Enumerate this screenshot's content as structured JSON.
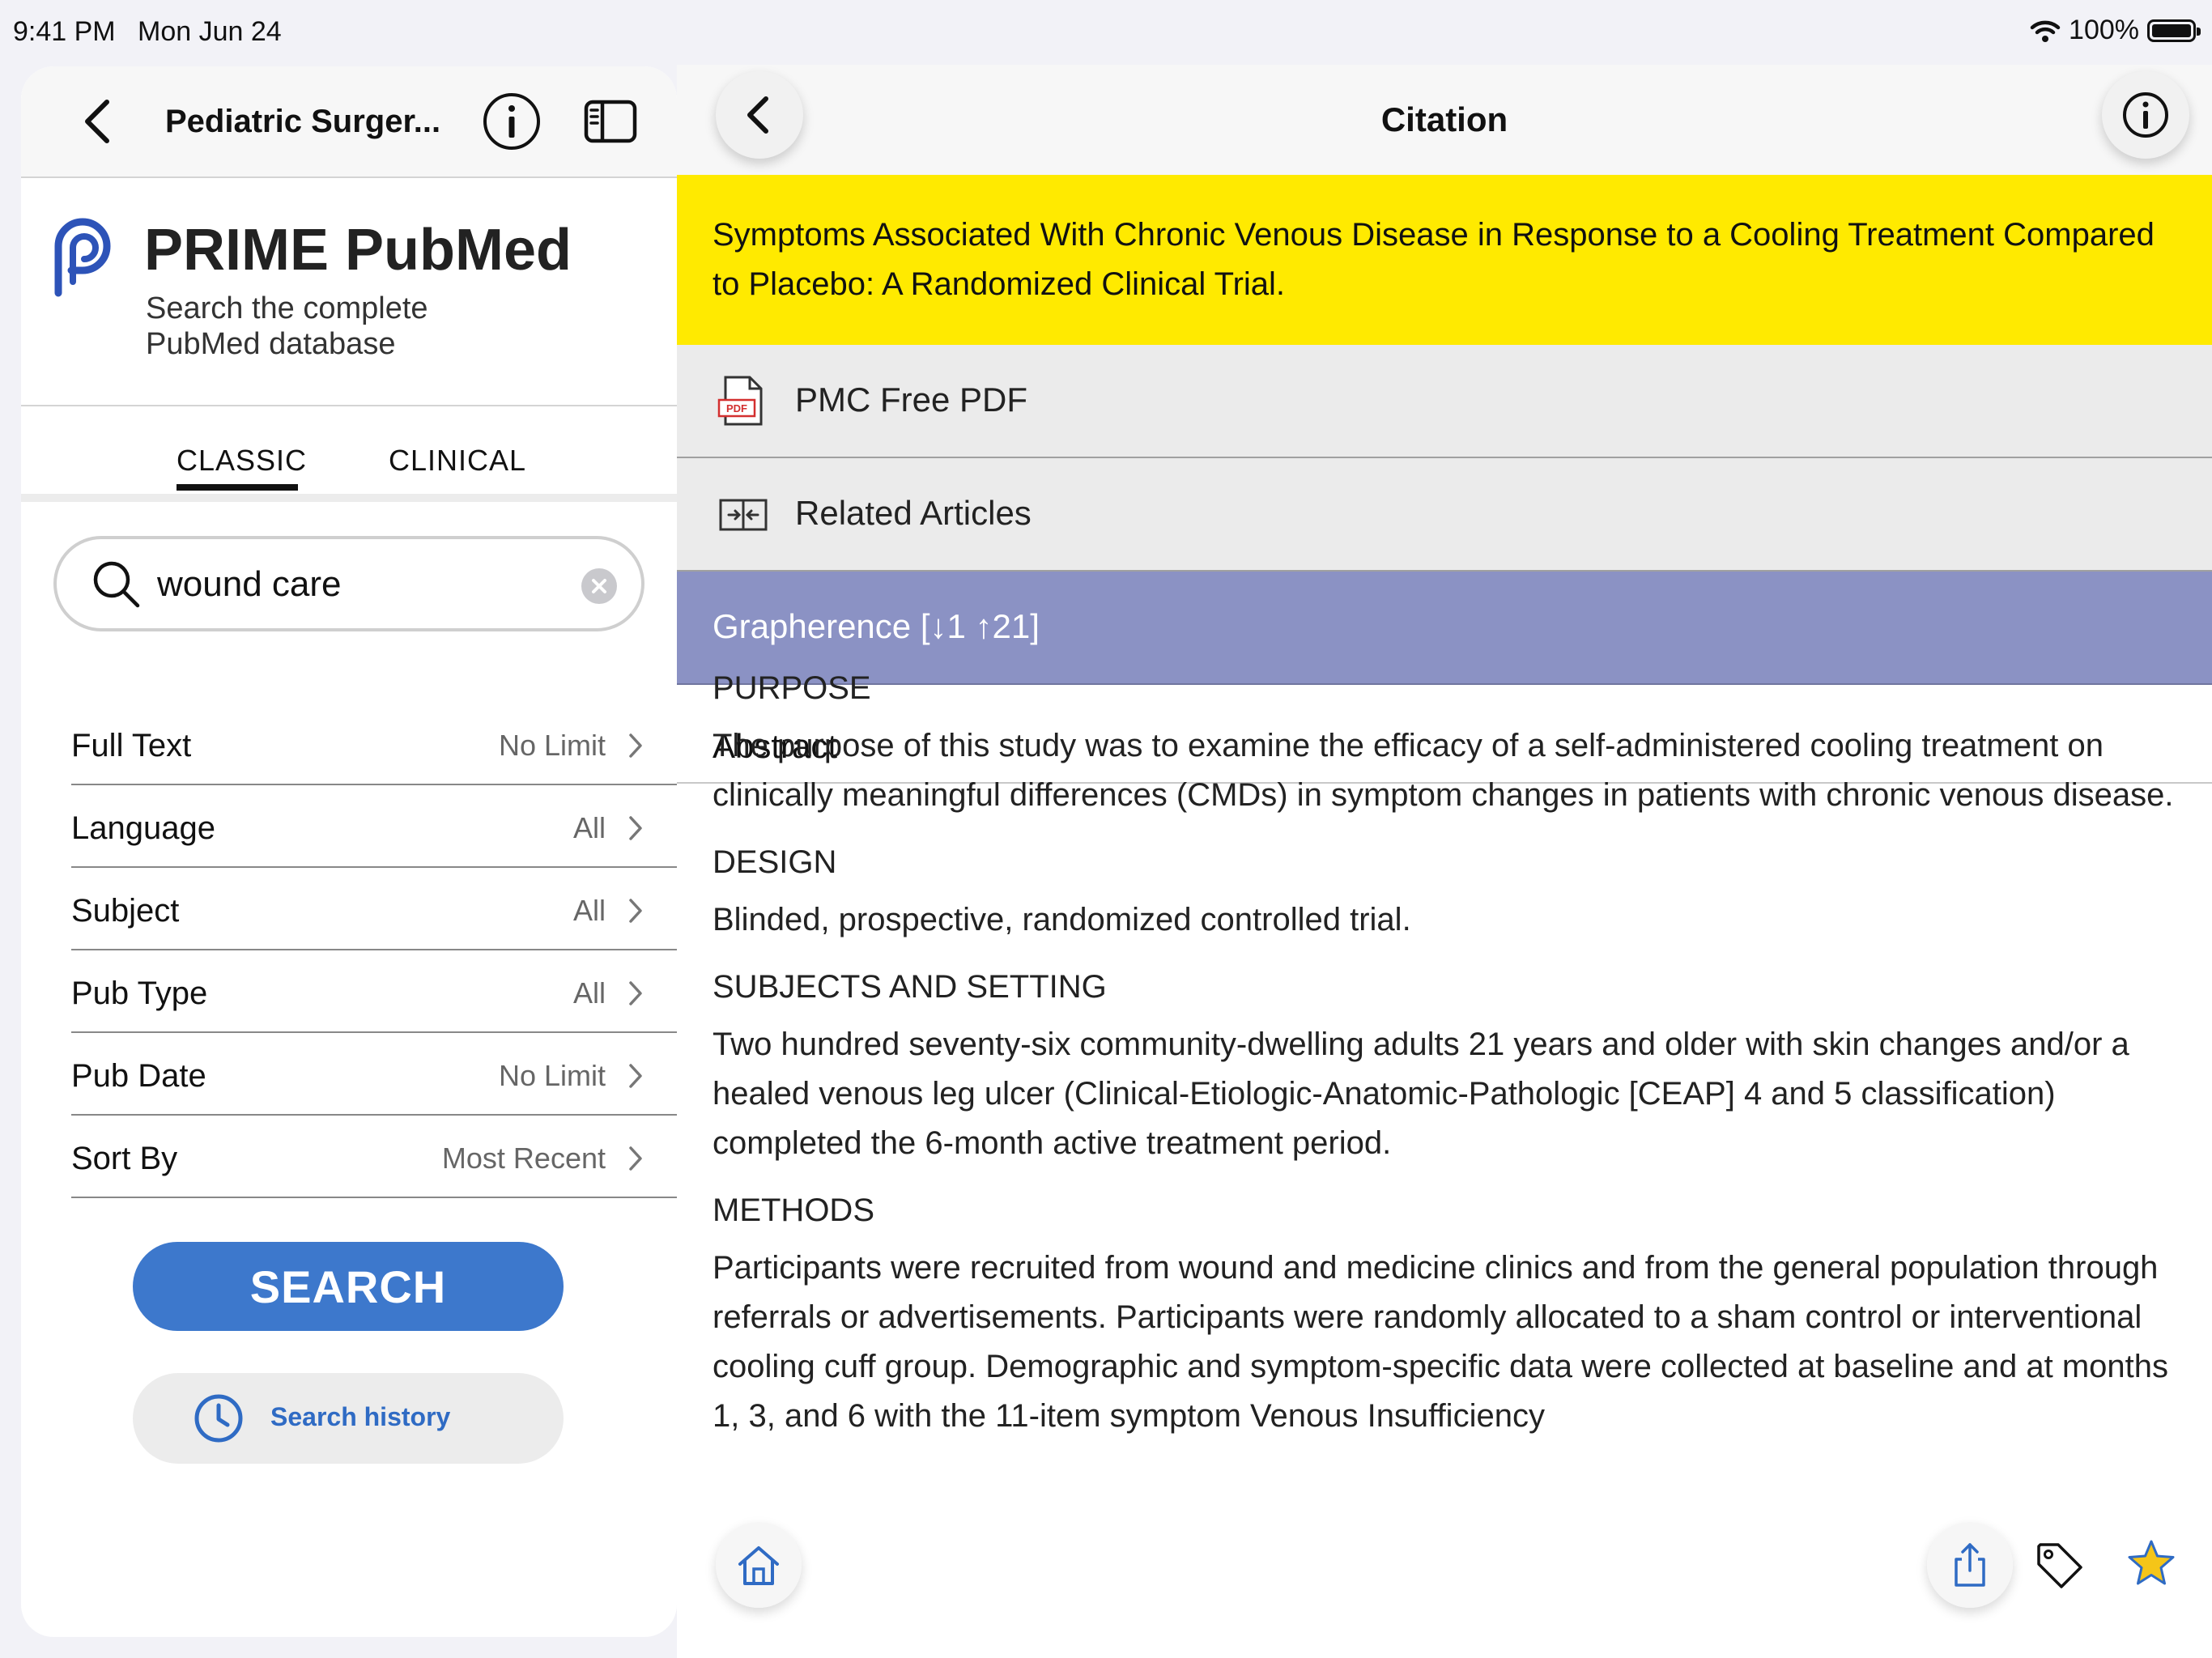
{
  "status_bar": {
    "time": "9:41 PM",
    "date": "Mon Jun 24",
    "battery": "100%"
  },
  "left": {
    "nav_title": "Pediatric Surger...",
    "brand": {
      "name": "PRIME PubMed",
      "tagline_1": "Search the complete",
      "tagline_2": "PubMed database"
    },
    "tabs": [
      {
        "label": "CLASSIC"
      },
      {
        "label": "CLINICAL"
      }
    ],
    "active_tab": "CLASSIC",
    "search": {
      "value": "wound care",
      "placeholder": ""
    },
    "filters": [
      {
        "label": "Full Text",
        "value": "No Limit"
      },
      {
        "label": "Language",
        "value": "All"
      },
      {
        "label": "Subject",
        "value": "All"
      },
      {
        "label": "Pub Type",
        "value": "All"
      },
      {
        "label": "Pub Date",
        "value": "No Limit"
      },
      {
        "label": "Sort By",
        "value": "Most Recent"
      }
    ],
    "search_button": "SEARCH",
    "history_button": "Search history"
  },
  "right": {
    "nav_title": "Citation",
    "article_title": "Symptoms Associated With Chronic Venous Disease in Response to a Cooling Treatment Compared to Placebo: A Randomized Clinical Trial.",
    "links": [
      {
        "label": "PMC Free PDF",
        "icon": "pdf-icon"
      },
      {
        "label": "Related Articles",
        "icon": "related-articles-icon"
      }
    ],
    "grapherence": "Grapherence [↓1 ↑21]",
    "abstract_header": "Abstract",
    "sections": [
      {
        "heading": "PURPOSE",
        "text": "The purpose of this study was to examine the efficacy of a self-administered cooling treatment on clinically meaningful differences (CMDs) in symptom changes in patients with chronic venous disease."
      },
      {
        "heading": "DESIGN",
        "text": "Blinded, prospective, randomized controlled trial."
      },
      {
        "heading": "SUBJECTS AND SETTING",
        "text": "Two hundred seventy-six community-dwelling adults 21 years and older with skin changes and/or a healed venous leg ulcer (Clinical-Etiologic-Anatomic-Pathologic [CEAP] 4 and 5 classification) completed the 6-month active treatment period."
      },
      {
        "heading": "METHODS",
        "text": "Participants were recruited from wound and medicine clinics and from the general population through referrals or advertisements. Participants were randomly allocated to a sham control or interventional cooling cuff group. Demographic and symptom-specific data were collected at baseline and at months 1, 3, and 6 with the 11-item symptom Venous Insufficiency"
      }
    ]
  },
  "colors": {
    "accent_blue": "#3d78cc",
    "highlight_yellow": "#ffea00",
    "grapherence_purple": "#8b92c4",
    "star_gold": "#f5c518"
  }
}
